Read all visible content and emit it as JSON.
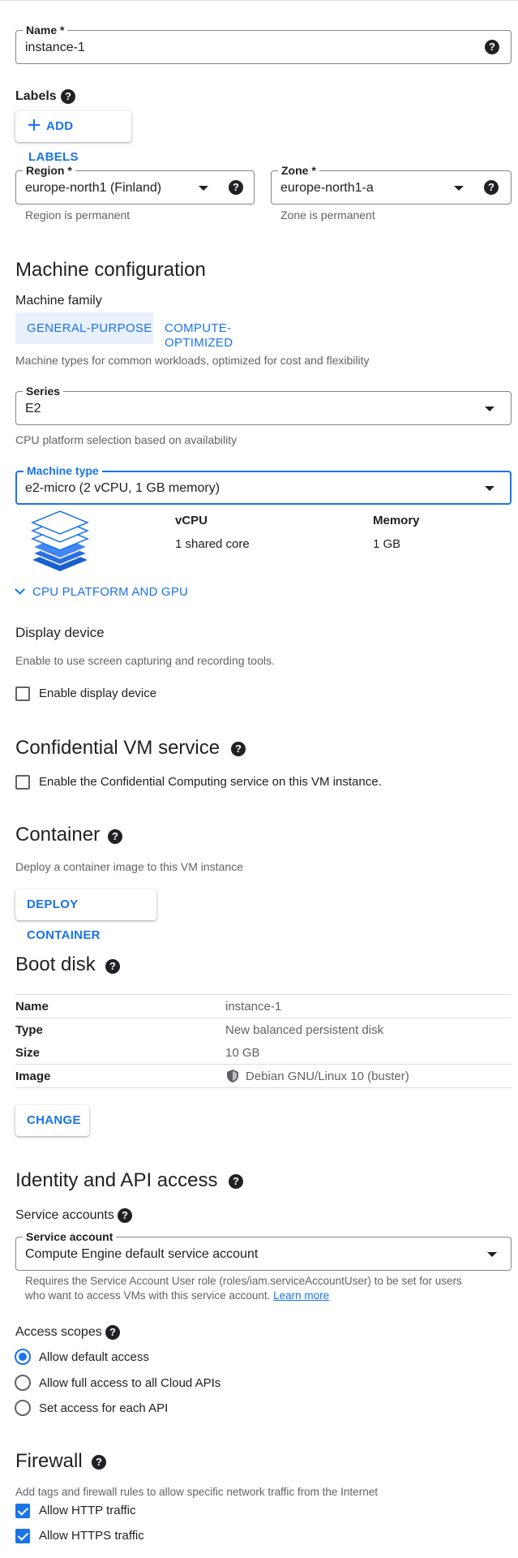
{
  "name_field": {
    "label": "Name *",
    "value": "instance-1"
  },
  "labels": {
    "title": "Labels",
    "add_button": "ADD LABELS"
  },
  "region": {
    "label": "Region *",
    "value": "europe-north1 (Finland)",
    "hint": "Region is permanent"
  },
  "zone": {
    "label": "Zone *",
    "value": "europe-north1-a",
    "hint": "Zone is permanent"
  },
  "machine_config": {
    "title": "Machine configuration",
    "family_label": "Machine family",
    "tabs": [
      {
        "label": "GENERAL-PURPOSE",
        "selected": true
      },
      {
        "label": "COMPUTE-OPTIMIZED",
        "selected": false
      }
    ],
    "family_description": "Machine types for common workloads, optimized for cost and flexibility",
    "series": {
      "label": "Series",
      "value": "E2",
      "hint": "CPU platform selection based on availability"
    },
    "machine_type": {
      "label": "Machine type",
      "value": "e2-micro (2 vCPU, 1 GB memory)"
    },
    "specs": {
      "vcpu_header": "vCPU",
      "vcpu_value": "1 shared core",
      "memory_header": "Memory",
      "memory_value": "1 GB"
    },
    "expand_link": "CPU PLATFORM AND GPU"
  },
  "display_device": {
    "title": "Display device",
    "description": "Enable to use screen capturing and recording tools.",
    "checkbox_label": "Enable display device",
    "checked": false
  },
  "confidential": {
    "title": "Confidential VM service",
    "checkbox_label": "Enable the Confidential Computing service on this VM instance.",
    "checked": false
  },
  "container": {
    "title": "Container",
    "description": "Deploy a container image to this VM instance",
    "button": "DEPLOY CONTAINER"
  },
  "boot_disk": {
    "title": "Boot disk",
    "rows": [
      {
        "key": "Name",
        "value": "instance-1"
      },
      {
        "key": "Type",
        "value": "New balanced persistent disk"
      },
      {
        "key": "Size",
        "value": "10 GB"
      },
      {
        "key": "Image",
        "value": "Debian GNU/Linux 10 (buster)"
      }
    ],
    "button": "CHANGE"
  },
  "identity": {
    "title": "Identity and API access",
    "service_accounts_label": "Service accounts",
    "service_account": {
      "label": "Service account",
      "value": "Compute Engine default service account"
    },
    "note_line1": "Requires the Service Account User role (roles/iam.serviceAccountUser) to be set for users",
    "note_line2": "who want to access VMs with this service account.",
    "learn_more": "Learn more",
    "access_scopes_label": "Access scopes",
    "scopes": [
      {
        "label": "Allow default access",
        "selected": true
      },
      {
        "label": "Allow full access to all Cloud APIs",
        "selected": false
      },
      {
        "label": "Set access for each API",
        "selected": false
      }
    ]
  },
  "firewall": {
    "title": "Firewall",
    "description": "Add tags and firewall rules to allow specific network traffic from the Internet",
    "options": [
      {
        "label": "Allow HTTP traffic",
        "checked": true
      },
      {
        "label": "Allow HTTPS traffic",
        "checked": true
      }
    ]
  },
  "icons": {
    "help": "help-icon",
    "add": "plus-icon",
    "dropdown": "caret-down-icon",
    "expand": "chevron-down-icon",
    "machine": "layers-icon",
    "image": "shield-icon"
  },
  "colors": {
    "accent": "#1a73e8",
    "tab_selected_bg": "#e8f0fe",
    "text": "#202124",
    "muted": "#5f6368"
  }
}
